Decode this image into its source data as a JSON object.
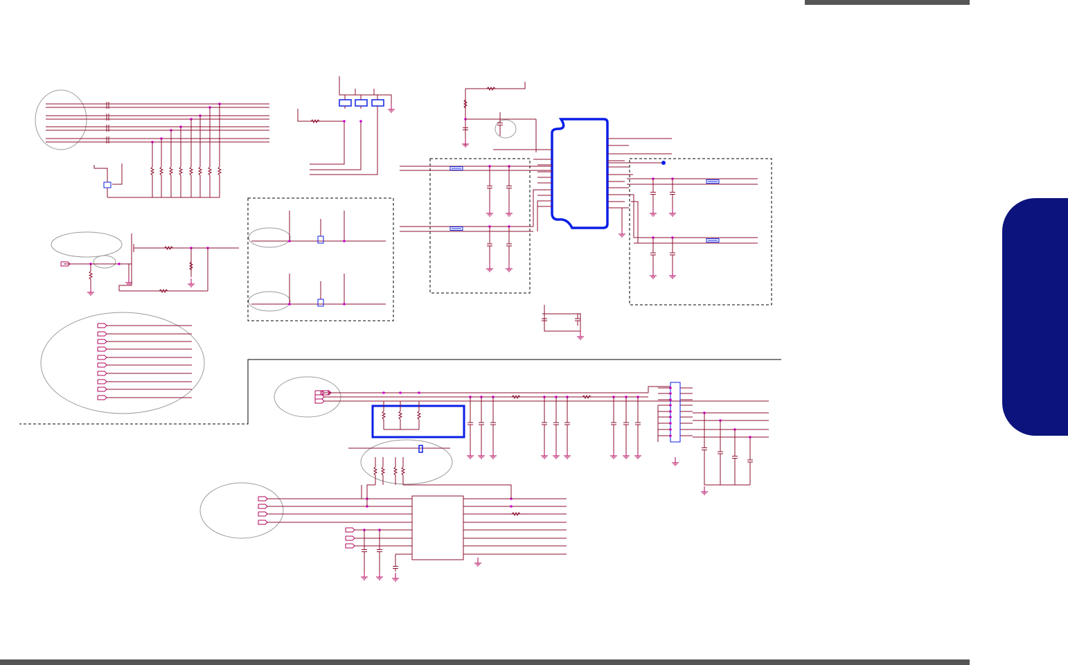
{
  "colors": {
    "rule": "#555555",
    "side_tab": "#0c137c",
    "wire": "#8b0d2b",
    "net_ground": "#b0005a",
    "junction": "#cc00cc",
    "highlight": "#0a1ee6",
    "annotation": "#9a9a9a",
    "dashed_box": "#000000"
  },
  "icons": [
    "ic-body",
    "connector-pins",
    "resistor",
    "capacitor",
    "inductor",
    "ground-symbol",
    "junction-dot",
    "flip-flop-chip"
  ]
}
